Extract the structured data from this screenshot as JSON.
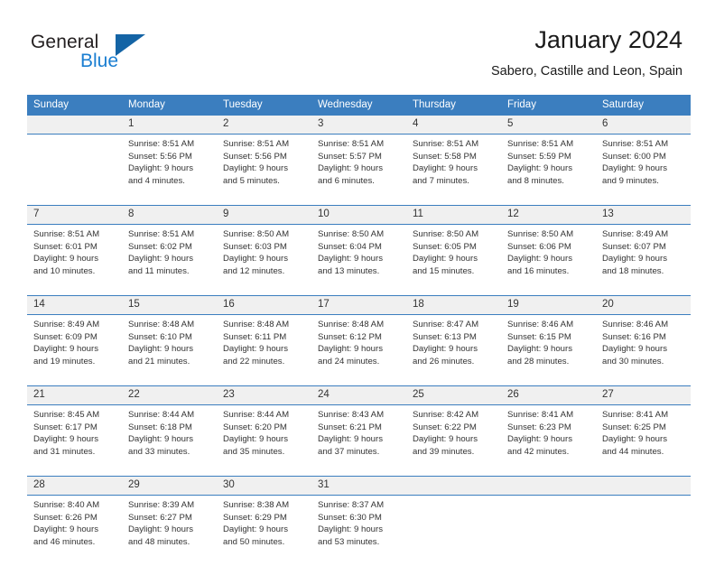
{
  "brand": {
    "name_part1": "General",
    "name_part2": "Blue",
    "logo_icon": "triangle-logo-icon"
  },
  "header": {
    "title": "January 2024",
    "subtitle": "Sabero, Castille and Leon, Spain"
  },
  "colors": {
    "header_blue": "#3b7ebf",
    "daynum_bg": "#f0f0f0",
    "brand_blue": "#1a7ed1",
    "logo_blue": "#1464a5",
    "text": "#333333"
  },
  "calendar": {
    "weekday_headers": [
      "Sunday",
      "Monday",
      "Tuesday",
      "Wednesday",
      "Thursday",
      "Friday",
      "Saturday"
    ],
    "weeks": [
      [
        {
          "day": "",
          "sunrise": "",
          "sunset": "",
          "daylight1": "",
          "daylight2": ""
        },
        {
          "day": "1",
          "sunrise": "Sunrise: 8:51 AM",
          "sunset": "Sunset: 5:56 PM",
          "daylight1": "Daylight: 9 hours",
          "daylight2": "and 4 minutes."
        },
        {
          "day": "2",
          "sunrise": "Sunrise: 8:51 AM",
          "sunset": "Sunset: 5:56 PM",
          "daylight1": "Daylight: 9 hours",
          "daylight2": "and 5 minutes."
        },
        {
          "day": "3",
          "sunrise": "Sunrise: 8:51 AM",
          "sunset": "Sunset: 5:57 PM",
          "daylight1": "Daylight: 9 hours",
          "daylight2": "and 6 minutes."
        },
        {
          "day": "4",
          "sunrise": "Sunrise: 8:51 AM",
          "sunset": "Sunset: 5:58 PM",
          "daylight1": "Daylight: 9 hours",
          "daylight2": "and 7 minutes."
        },
        {
          "day": "5",
          "sunrise": "Sunrise: 8:51 AM",
          "sunset": "Sunset: 5:59 PM",
          "daylight1": "Daylight: 9 hours",
          "daylight2": "and 8 minutes."
        },
        {
          "day": "6",
          "sunrise": "Sunrise: 8:51 AM",
          "sunset": "Sunset: 6:00 PM",
          "daylight1": "Daylight: 9 hours",
          "daylight2": "and 9 minutes."
        }
      ],
      [
        {
          "day": "7",
          "sunrise": "Sunrise: 8:51 AM",
          "sunset": "Sunset: 6:01 PM",
          "daylight1": "Daylight: 9 hours",
          "daylight2": "and 10 minutes."
        },
        {
          "day": "8",
          "sunrise": "Sunrise: 8:51 AM",
          "sunset": "Sunset: 6:02 PM",
          "daylight1": "Daylight: 9 hours",
          "daylight2": "and 11 minutes."
        },
        {
          "day": "9",
          "sunrise": "Sunrise: 8:50 AM",
          "sunset": "Sunset: 6:03 PM",
          "daylight1": "Daylight: 9 hours",
          "daylight2": "and 12 minutes."
        },
        {
          "day": "10",
          "sunrise": "Sunrise: 8:50 AM",
          "sunset": "Sunset: 6:04 PM",
          "daylight1": "Daylight: 9 hours",
          "daylight2": "and 13 minutes."
        },
        {
          "day": "11",
          "sunrise": "Sunrise: 8:50 AM",
          "sunset": "Sunset: 6:05 PM",
          "daylight1": "Daylight: 9 hours",
          "daylight2": "and 15 minutes."
        },
        {
          "day": "12",
          "sunrise": "Sunrise: 8:50 AM",
          "sunset": "Sunset: 6:06 PM",
          "daylight1": "Daylight: 9 hours",
          "daylight2": "and 16 minutes."
        },
        {
          "day": "13",
          "sunrise": "Sunrise: 8:49 AM",
          "sunset": "Sunset: 6:07 PM",
          "daylight1": "Daylight: 9 hours",
          "daylight2": "and 18 minutes."
        }
      ],
      [
        {
          "day": "14",
          "sunrise": "Sunrise: 8:49 AM",
          "sunset": "Sunset: 6:09 PM",
          "daylight1": "Daylight: 9 hours",
          "daylight2": "and 19 minutes."
        },
        {
          "day": "15",
          "sunrise": "Sunrise: 8:48 AM",
          "sunset": "Sunset: 6:10 PM",
          "daylight1": "Daylight: 9 hours",
          "daylight2": "and 21 minutes."
        },
        {
          "day": "16",
          "sunrise": "Sunrise: 8:48 AM",
          "sunset": "Sunset: 6:11 PM",
          "daylight1": "Daylight: 9 hours",
          "daylight2": "and 22 minutes."
        },
        {
          "day": "17",
          "sunrise": "Sunrise: 8:48 AM",
          "sunset": "Sunset: 6:12 PM",
          "daylight1": "Daylight: 9 hours",
          "daylight2": "and 24 minutes."
        },
        {
          "day": "18",
          "sunrise": "Sunrise: 8:47 AM",
          "sunset": "Sunset: 6:13 PM",
          "daylight1": "Daylight: 9 hours",
          "daylight2": "and 26 minutes."
        },
        {
          "day": "19",
          "sunrise": "Sunrise: 8:46 AM",
          "sunset": "Sunset: 6:15 PM",
          "daylight1": "Daylight: 9 hours",
          "daylight2": "and 28 minutes."
        },
        {
          "day": "20",
          "sunrise": "Sunrise: 8:46 AM",
          "sunset": "Sunset: 6:16 PM",
          "daylight1": "Daylight: 9 hours",
          "daylight2": "and 30 minutes."
        }
      ],
      [
        {
          "day": "21",
          "sunrise": "Sunrise: 8:45 AM",
          "sunset": "Sunset: 6:17 PM",
          "daylight1": "Daylight: 9 hours",
          "daylight2": "and 31 minutes."
        },
        {
          "day": "22",
          "sunrise": "Sunrise: 8:44 AM",
          "sunset": "Sunset: 6:18 PM",
          "daylight1": "Daylight: 9 hours",
          "daylight2": "and 33 minutes."
        },
        {
          "day": "23",
          "sunrise": "Sunrise: 8:44 AM",
          "sunset": "Sunset: 6:20 PM",
          "daylight1": "Daylight: 9 hours",
          "daylight2": "and 35 minutes."
        },
        {
          "day": "24",
          "sunrise": "Sunrise: 8:43 AM",
          "sunset": "Sunset: 6:21 PM",
          "daylight1": "Daylight: 9 hours",
          "daylight2": "and 37 minutes."
        },
        {
          "day": "25",
          "sunrise": "Sunrise: 8:42 AM",
          "sunset": "Sunset: 6:22 PM",
          "daylight1": "Daylight: 9 hours",
          "daylight2": "and 39 minutes."
        },
        {
          "day": "26",
          "sunrise": "Sunrise: 8:41 AM",
          "sunset": "Sunset: 6:23 PM",
          "daylight1": "Daylight: 9 hours",
          "daylight2": "and 42 minutes."
        },
        {
          "day": "27",
          "sunrise": "Sunrise: 8:41 AM",
          "sunset": "Sunset: 6:25 PM",
          "daylight1": "Daylight: 9 hours",
          "daylight2": "and 44 minutes."
        }
      ],
      [
        {
          "day": "28",
          "sunrise": "Sunrise: 8:40 AM",
          "sunset": "Sunset: 6:26 PM",
          "daylight1": "Daylight: 9 hours",
          "daylight2": "and 46 minutes."
        },
        {
          "day": "29",
          "sunrise": "Sunrise: 8:39 AM",
          "sunset": "Sunset: 6:27 PM",
          "daylight1": "Daylight: 9 hours",
          "daylight2": "and 48 minutes."
        },
        {
          "day": "30",
          "sunrise": "Sunrise: 8:38 AM",
          "sunset": "Sunset: 6:29 PM",
          "daylight1": "Daylight: 9 hours",
          "daylight2": "and 50 minutes."
        },
        {
          "day": "31",
          "sunrise": "Sunrise: 8:37 AM",
          "sunset": "Sunset: 6:30 PM",
          "daylight1": "Daylight: 9 hours",
          "daylight2": "and 53 minutes."
        },
        {
          "day": "",
          "sunrise": "",
          "sunset": "",
          "daylight1": "",
          "daylight2": ""
        },
        {
          "day": "",
          "sunrise": "",
          "sunset": "",
          "daylight1": "",
          "daylight2": ""
        },
        {
          "day": "",
          "sunrise": "",
          "sunset": "",
          "daylight1": "",
          "daylight2": ""
        }
      ]
    ]
  }
}
